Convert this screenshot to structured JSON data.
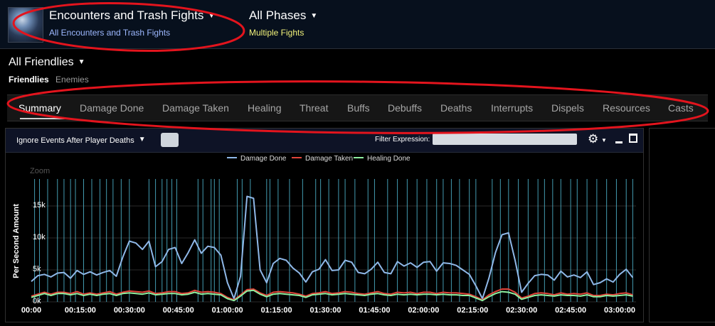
{
  "header": {
    "encounter_title": "Encounters and Trash Fights",
    "encounter_sub": "All Encounters and Trash Fights",
    "phase_title": "All Phases",
    "phase_sub": "Multiple Fights"
  },
  "friendlies": {
    "title": "All Friendlies",
    "tabs": [
      "Friendlies",
      "Enemies"
    ],
    "active": "Friendlies"
  },
  "tabs": [
    "Summary",
    "Damage Done",
    "Damage Taken",
    "Healing",
    "Threat",
    "Buffs",
    "Debuffs",
    "Deaths",
    "Interrupts",
    "Dispels",
    "Resources",
    "Casts"
  ],
  "active_tab": "Summary",
  "panel": {
    "ignore_label": "Ignore Events After Player Deaths",
    "filter_label": "Filter Expression:",
    "filter_value": ""
  },
  "colors": {
    "damage_done": "#8fb8e8",
    "damage_taken": "#e0443a",
    "healing_done": "#8ff0a0",
    "annotation": "#e3141d",
    "event_lines": "#4fb7cf"
  },
  "chart_data": {
    "type": "line",
    "zoom_label": "Zoom",
    "ylabel": "Per Second Amount",
    "xlabel": "",
    "ylim": [
      0,
      19000
    ],
    "xlim": [
      0,
      185
    ],
    "x_ticks": [
      {
        "v": 0,
        "label": "00:00"
      },
      {
        "v": 15,
        "label": "00:15:00"
      },
      {
        "v": 30,
        "label": "00:30:00"
      },
      {
        "v": 45,
        "label": "00:45:00"
      },
      {
        "v": 60,
        "label": "01:00:00"
      },
      {
        "v": 75,
        "label": "01:15:00"
      },
      {
        "v": 90,
        "label": "01:30:00"
      },
      {
        "v": 105,
        "label": "01:45:00"
      },
      {
        "v": 120,
        "label": "02:00:00"
      },
      {
        "v": 135,
        "label": "02:15:00"
      },
      {
        "v": 150,
        "label": "02:30:00"
      },
      {
        "v": 165,
        "label": "02:45:00"
      },
      {
        "v": 180,
        "label": "03:00:00"
      }
    ],
    "y_ticks": [
      {
        "v": 0,
        "label": "0k"
      },
      {
        "v": 5000,
        "label": "5k"
      },
      {
        "v": 10000,
        "label": "10k"
      },
      {
        "v": 15000,
        "label": "15k"
      }
    ],
    "event_markers": [
      1,
      2.5,
      5,
      8,
      10,
      12,
      13.5,
      16,
      18.5,
      21,
      23,
      25,
      27.5,
      30,
      36,
      38,
      40,
      41.5,
      43,
      44.5,
      51,
      52.5,
      55,
      56,
      57.5,
      63,
      64.5,
      67,
      72,
      73,
      75.5,
      79,
      83,
      87,
      88.5,
      91,
      94,
      96,
      99,
      103,
      105,
      109,
      112,
      115,
      118,
      121,
      124,
      126,
      128.5,
      131,
      134,
      136,
      141,
      143.5,
      146,
      149,
      152,
      155,
      157,
      159.5,
      162,
      165,
      167,
      170,
      173,
      176,
      179,
      182,
      184
    ],
    "series": [
      {
        "name": "Damage Done",
        "x": [
          0,
          2,
          4,
          6,
          8,
          10,
          12,
          14,
          16,
          18,
          20,
          22,
          24,
          26,
          28,
          30,
          32,
          34,
          36,
          38,
          40,
          42,
          44,
          46,
          48,
          50,
          52,
          54,
          56,
          58,
          60,
          62,
          64,
          66,
          68,
          70,
          72,
          74,
          76,
          78,
          80,
          82,
          84,
          86,
          88,
          90,
          92,
          94,
          96,
          98,
          100,
          102,
          104,
          106,
          108,
          110,
          112,
          114,
          116,
          118,
          120,
          122,
          124,
          126,
          128,
          130,
          132,
          134,
          136,
          138,
          140,
          142,
          144,
          146,
          148,
          150,
          152,
          154,
          156,
          158,
          160,
          162,
          164,
          166,
          168,
          170,
          172,
          174,
          176,
          178,
          180,
          182,
          184
        ],
        "values": [
          3200,
          4100,
          4300,
          3900,
          4500,
          4600,
          3700,
          4900,
          4300,
          4700,
          4200,
          4600,
          4900,
          4000,
          7000,
          9500,
          9200,
          8200,
          9500,
          5500,
          6300,
          8200,
          8500,
          6000,
          7700,
          9700,
          7600,
          8700,
          8500,
          7300,
          3000,
          500,
          4000,
          16500,
          16200,
          5000,
          3000,
          6000,
          6800,
          6500,
          5300,
          4500,
          3100,
          4700,
          5100,
          6600,
          4900,
          5000,
          6500,
          6200,
          4600,
          4400,
          5100,
          6200,
          4600,
          4400,
          6300,
          5600,
          6100,
          5400,
          6200,
          6300,
          4800,
          6100,
          6000,
          5700,
          5000,
          4300,
          2500,
          500,
          3700,
          7700,
          10500,
          10800,
          6500,
          1500,
          2900,
          4100,
          4300,
          4200,
          3400,
          4800,
          3900,
          4200,
          3800,
          4700,
          2700,
          3000,
          3600,
          3100,
          4300,
          5100,
          3800
        ]
      },
      {
        "name": "Damage Taken",
        "x": [
          0,
          2,
          4,
          6,
          8,
          10,
          12,
          14,
          16,
          18,
          20,
          22,
          24,
          26,
          28,
          30,
          32,
          34,
          36,
          38,
          40,
          42,
          44,
          46,
          48,
          50,
          52,
          54,
          56,
          58,
          60,
          62,
          64,
          66,
          68,
          70,
          72,
          74,
          76,
          78,
          80,
          82,
          84,
          86,
          88,
          90,
          92,
          94,
          96,
          98,
          100,
          102,
          104,
          106,
          108,
          110,
          112,
          114,
          116,
          118,
          120,
          122,
          124,
          126,
          128,
          130,
          132,
          134,
          136,
          138,
          140,
          142,
          144,
          146,
          148,
          150,
          152,
          154,
          156,
          158,
          160,
          162,
          164,
          166,
          168,
          170,
          172,
          174,
          176,
          178,
          180,
          182,
          184
        ],
        "values": [
          900,
          1200,
          1500,
          1200,
          1500,
          1500,
          1300,
          1600,
          1200,
          1400,
          1200,
          1400,
          1600,
          1200,
          1500,
          1700,
          1600,
          1500,
          1700,
          1300,
          1400,
          1600,
          1600,
          1300,
          1400,
          1800,
          1500,
          1600,
          1500,
          1300,
          700,
          300,
          1100,
          1900,
          2000,
          1400,
          1000,
          1500,
          1600,
          1500,
          1400,
          1200,
          900,
          1300,
          1400,
          1600,
          1300,
          1400,
          1600,
          1500,
          1300,
          1200,
          1400,
          1600,
          1300,
          1200,
          1500,
          1400,
          1500,
          1300,
          1500,
          1500,
          1300,
          1500,
          1400,
          1400,
          1300,
          1200,
          800,
          300,
          1100,
          1600,
          2000,
          2000,
          1500,
          600,
          900,
          1300,
          1400,
          1300,
          1100,
          1400,
          1200,
          1300,
          1200,
          1400,
          1000,
          1000,
          1200,
          1100,
          1300,
          1400,
          1100
        ]
      },
      {
        "name": "Healing Done",
        "x": [
          0,
          2,
          4,
          6,
          8,
          10,
          12,
          14,
          16,
          18,
          20,
          22,
          24,
          26,
          28,
          30,
          32,
          34,
          36,
          38,
          40,
          42,
          44,
          46,
          48,
          50,
          52,
          54,
          56,
          58,
          60,
          62,
          64,
          66,
          68,
          70,
          72,
          74,
          76,
          78,
          80,
          82,
          84,
          86,
          88,
          90,
          92,
          94,
          96,
          98,
          100,
          102,
          104,
          106,
          108,
          110,
          112,
          114,
          116,
          118,
          120,
          122,
          124,
          126,
          128,
          130,
          132,
          134,
          136,
          138,
          140,
          142,
          144,
          146,
          148,
          150,
          152,
          154,
          156,
          158,
          160,
          162,
          164,
          166,
          168,
          170,
          172,
          174,
          176,
          178,
          180,
          182,
          184
        ],
        "values": [
          700,
          1000,
          1300,
          1000,
          1300,
          1300,
          1100,
          1300,
          1000,
          1200,
          1000,
          1200,
          1300,
          1000,
          1300,
          1400,
          1300,
          1200,
          1400,
          1100,
          1200,
          1300,
          1300,
          1100,
          1200,
          1500,
          1200,
          1300,
          1200,
          1100,
          500,
          200,
          900,
          1700,
          1800,
          1200,
          800,
          1200,
          1300,
          1200,
          1100,
          1000,
          700,
          1100,
          1200,
          1300,
          1100,
          1200,
          1300,
          1200,
          1100,
          1000,
          1200,
          1300,
          1100,
          1000,
          1200,
          1100,
          1200,
          1100,
          1200,
          1200,
          1100,
          1200,
          1100,
          1100,
          1000,
          1000,
          600,
          200,
          800,
          1300,
          1600,
          1500,
          1200,
          400,
          700,
          1000,
          1100,
          1000,
          900,
          1100,
          1000,
          1000,
          900,
          1100,
          800,
          800,
          1000,
          900,
          1000,
          1100,
          900
        ]
      }
    ],
    "legend_position": "top-center",
    "grid": true
  }
}
